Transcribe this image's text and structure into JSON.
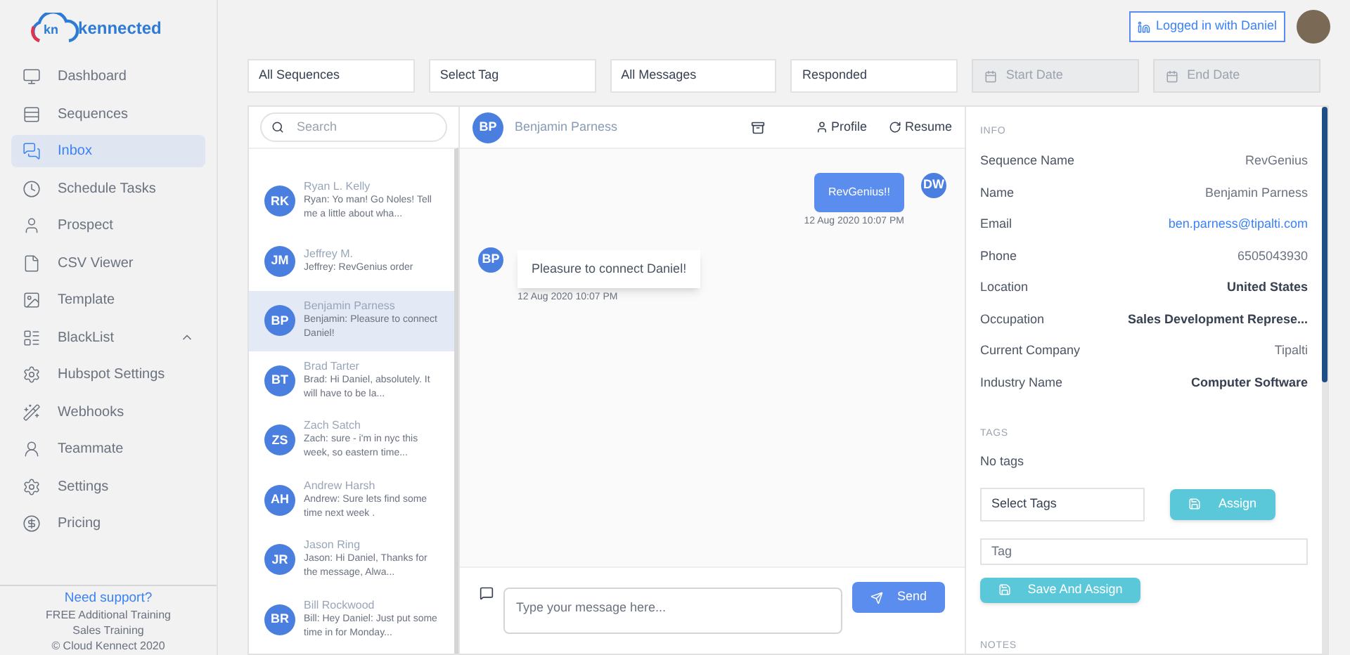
{
  "logo": {
    "mark": "kn",
    "name": "kennected"
  },
  "sidebar": {
    "items": [
      {
        "label": "Dashboard",
        "kind": "link",
        "selected": false
      },
      {
        "label": "Sequences",
        "kind": "link",
        "selected": false
      },
      {
        "label": "Inbox",
        "kind": "link",
        "selected": true
      },
      {
        "label": "Schedule Tasks",
        "kind": "link",
        "selected": false
      },
      {
        "label": "Prospect",
        "kind": "link",
        "selected": false
      },
      {
        "label": "CSV Viewer",
        "kind": "link",
        "selected": false
      },
      {
        "label": "Template",
        "kind": "link",
        "selected": false
      },
      {
        "label": "BlackList",
        "kind": "group",
        "selected": false,
        "expanded": true
      },
      {
        "label": "Hubspot Settings",
        "kind": "link",
        "selected": false
      },
      {
        "label": "Webhooks",
        "kind": "link",
        "selected": false
      },
      {
        "label": "Teammate",
        "kind": "link",
        "selected": false
      },
      {
        "label": "Settings",
        "kind": "link",
        "selected": false
      },
      {
        "label": "Pricing",
        "kind": "link",
        "selected": false
      }
    ],
    "support": {
      "title": "Need support?",
      "links": [
        "FREE Additional Training",
        "Sales Training"
      ],
      "copyright": "© Cloud Kennect 2020"
    }
  },
  "header": {
    "login": "Logged in with Daniel"
  },
  "filters": [
    {
      "kind": "select",
      "value": "All Sequences"
    },
    {
      "kind": "select",
      "value": "Select Tag"
    },
    {
      "kind": "select",
      "value": "All Messages"
    },
    {
      "kind": "select",
      "value": "Responded"
    },
    {
      "kind": "date",
      "placeholder": "Start Date"
    },
    {
      "kind": "date",
      "placeholder": "End Date"
    }
  ],
  "conversations": {
    "search": {
      "placeholder": "Search"
    },
    "items": [
      {
        "initials": "RK",
        "name": "Ryan L. Kelly",
        "sender": "Ryan:",
        "preview": "Yo man! Go Noles! Tell me a little about wha...",
        "selected": false
      },
      {
        "initials": "JM",
        "name": "Jeffrey M.",
        "sender": "Jeffrey:",
        "preview": "RevGenius order",
        "selected": false
      },
      {
        "initials": "BP",
        "name": "Benjamin Parness",
        "sender": "Benjamin:",
        "preview": "Pleasure to connect Daniel!",
        "selected": true
      },
      {
        "initials": "BT",
        "name": "Brad Tarter",
        "sender": "Brad:",
        "preview": "Hi Daniel, absolutely. It will have to be la...",
        "selected": false
      },
      {
        "initials": "ZS",
        "name": "Zach Satch",
        "sender": "Zach:",
        "preview": "sure - i'm in nyc this week, so eastern time...",
        "selected": false
      },
      {
        "initials": "AH",
        "name": "Andrew Harsh",
        "sender": "Andrew:",
        "preview": "Sure lets find some time next week .",
        "selected": false
      },
      {
        "initials": "JR",
        "name": "Jason Ring",
        "sender": "Jason:",
        "preview": "Hi Daniel, Thanks for the message, Alwa...",
        "selected": false
      },
      {
        "initials": "BR",
        "name": "Bill Rockwood",
        "sender": "Bill:",
        "preview": "Hey Daniel: Just put some time in for Monday...",
        "selected": false
      }
    ]
  },
  "chat": {
    "initials": "BP",
    "name": "Benjamin Parness",
    "actions": [
      "Profile",
      "Resume"
    ],
    "messages": [
      {
        "kind": "outgoing",
        "initials": "DW",
        "text": "RevGenius!!",
        "time": "12 Aug 2020 10:07 PM"
      },
      {
        "kind": "incoming",
        "initials": "BP",
        "text": "Pleasure to connect Daniel!",
        "time": "12 Aug 2020 10:07 PM"
      }
    ],
    "composer": {
      "placeholder": "Type your message here...",
      "send": "Send"
    }
  },
  "info": {
    "title": "INFO",
    "fields": [
      {
        "label": "Sequence Name",
        "value": "RevGenius",
        "kind": "text"
      },
      {
        "label": "Name",
        "value": "Benjamin Parness",
        "kind": "text"
      },
      {
        "label": "Email",
        "value": "ben.parness@tipalti.com",
        "kind": "link"
      },
      {
        "label": "Phone",
        "value": "6505043930",
        "kind": "text"
      },
      {
        "label": "Location",
        "value": "United States",
        "kind": "strong"
      },
      {
        "label": "Occupation",
        "value": "Sales Development Represe...",
        "kind": "strong"
      },
      {
        "label": "Current Company",
        "value": "Tipalti",
        "kind": "text"
      },
      {
        "label": "Industry Name",
        "value": "Computer Software",
        "kind": "strong"
      }
    ],
    "tags": {
      "title": "TAGS",
      "empty": "No tags",
      "select": "Select Tags",
      "assign": "Assign",
      "tag_placeholder": "Tag",
      "save": "Save And Assign"
    },
    "notes_title": "NOTES"
  }
}
